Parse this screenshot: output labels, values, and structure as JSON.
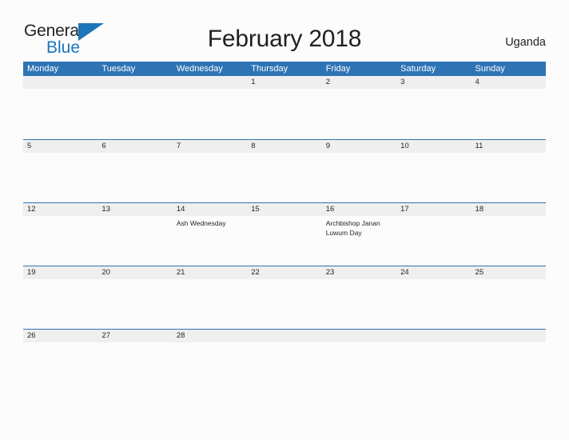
{
  "brand": {
    "name_part1": "General",
    "name_part2": "Blue",
    "flag_icon": "flag-triangle-icon",
    "accent_color": "#1b75bb"
  },
  "header": {
    "title": "February 2018",
    "country": "Uganda"
  },
  "colors": {
    "header_blue": "#2e74b5",
    "date_band_gray": "#efefef",
    "page_background": "#fcfcfd",
    "text": "#231f20"
  },
  "calendar": {
    "month": "February",
    "year": "2018",
    "weekday_headers": [
      "Monday",
      "Tuesday",
      "Wednesday",
      "Thursday",
      "Friday",
      "Saturday",
      "Sunday"
    ],
    "weeks": [
      {
        "short": false,
        "days": [
          {
            "number": "",
            "empty": true,
            "events": []
          },
          {
            "number": "",
            "empty": true,
            "events": []
          },
          {
            "number": "",
            "empty": true,
            "events": []
          },
          {
            "number": "1",
            "empty": false,
            "events": []
          },
          {
            "number": "2",
            "empty": false,
            "events": []
          },
          {
            "number": "3",
            "empty": false,
            "events": []
          },
          {
            "number": "4",
            "empty": false,
            "events": []
          }
        ]
      },
      {
        "short": false,
        "days": [
          {
            "number": "5",
            "empty": false,
            "events": []
          },
          {
            "number": "6",
            "empty": false,
            "events": []
          },
          {
            "number": "7",
            "empty": false,
            "events": []
          },
          {
            "number": "8",
            "empty": false,
            "events": []
          },
          {
            "number": "9",
            "empty": false,
            "events": []
          },
          {
            "number": "10",
            "empty": false,
            "events": []
          },
          {
            "number": "11",
            "empty": false,
            "events": []
          }
        ]
      },
      {
        "short": false,
        "days": [
          {
            "number": "12",
            "empty": false,
            "events": []
          },
          {
            "number": "13",
            "empty": false,
            "events": []
          },
          {
            "number": "14",
            "empty": false,
            "events": [
              "Ash Wednesday"
            ]
          },
          {
            "number": "15",
            "empty": false,
            "events": []
          },
          {
            "number": "16",
            "empty": false,
            "events": [
              "Archbishop Janan Luwum Day"
            ]
          },
          {
            "number": "17",
            "empty": false,
            "events": []
          },
          {
            "number": "18",
            "empty": false,
            "events": []
          }
        ]
      },
      {
        "short": false,
        "days": [
          {
            "number": "19",
            "empty": false,
            "events": []
          },
          {
            "number": "20",
            "empty": false,
            "events": []
          },
          {
            "number": "21",
            "empty": false,
            "events": []
          },
          {
            "number": "22",
            "empty": false,
            "events": []
          },
          {
            "number": "23",
            "empty": false,
            "events": []
          },
          {
            "number": "24",
            "empty": false,
            "events": []
          },
          {
            "number": "25",
            "empty": false,
            "events": []
          }
        ]
      },
      {
        "short": true,
        "days": [
          {
            "number": "26",
            "empty": false,
            "events": []
          },
          {
            "number": "27",
            "empty": false,
            "events": []
          },
          {
            "number": "28",
            "empty": false,
            "events": []
          },
          {
            "number": "",
            "empty": true,
            "events": []
          },
          {
            "number": "",
            "empty": true,
            "events": []
          },
          {
            "number": "",
            "empty": true,
            "events": []
          },
          {
            "number": "",
            "empty": true,
            "events": []
          }
        ]
      }
    ]
  }
}
